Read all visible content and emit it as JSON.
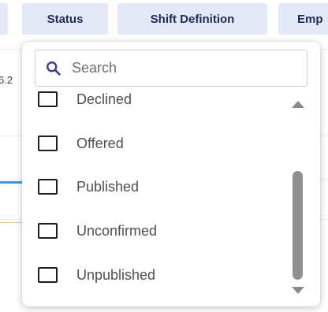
{
  "filter_bar": {
    "chips": [
      {
        "label": ""
      },
      {
        "label": "Status"
      },
      {
        "label": "Shift Definition"
      },
      {
        "label": "Emp"
      }
    ]
  },
  "background": {
    "cell_text": "6.2"
  },
  "dropdown": {
    "search": {
      "placeholder": "Search",
      "value": "",
      "icon": "search-icon"
    },
    "options": [
      {
        "label": "Declined",
        "checked": false
      },
      {
        "label": "Offered",
        "checked": false
      },
      {
        "label": "Published",
        "checked": false
      },
      {
        "label": "Unconfirmed",
        "checked": false
      },
      {
        "label": "Unpublished",
        "checked": false
      }
    ]
  },
  "colors": {
    "chip_bg": "#e3e9f7",
    "chip_text": "#1f2a56",
    "search_icon": "#3b3f8f"
  }
}
